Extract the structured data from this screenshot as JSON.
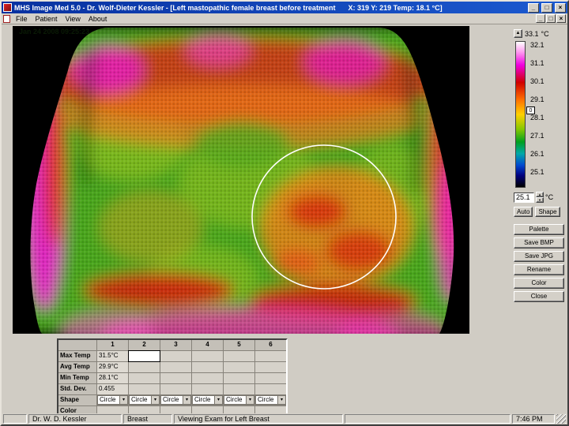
{
  "window": {
    "title_left": "MHS Image Med 5.0  -  Dr. Wolf-Dieter Kessler - [Left mastopathic female breast before treatment",
    "title_right": "X: 319  Y: 219    Temp:  18.1 °C]",
    "controls": {
      "minimize": "_",
      "maximize": "□",
      "close": "×"
    }
  },
  "menu": {
    "items": [
      "File",
      "Patient",
      "View",
      "About"
    ]
  },
  "image": {
    "timestamp": "Jan 24 2008 09:25:23"
  },
  "scale": {
    "unit": "°C",
    "max_label": "33.1",
    "labels": [
      "32.1",
      "31.1",
      "30.1",
      "29.1",
      "28.1",
      "27.1",
      "26.1",
      "25.1"
    ],
    "marker": "0",
    "current": "25.1",
    "auto_label": "Auto",
    "shape_label": "Shape",
    "palette_colors": [
      "#ffffff",
      "#ff9cf0",
      "#f000e0",
      "#d00000",
      "#ff7000",
      "#ffd000",
      "#88c800",
      "#00a020",
      "#00a8a8",
      "#0048d0",
      "#000080",
      "#000000"
    ]
  },
  "sidebar_buttons": [
    "Palette",
    "Save BMP",
    "Save JPG",
    "Rename",
    "Color",
    "Close"
  ],
  "stats_table": {
    "columns": [
      "1",
      "2",
      "3",
      "4",
      "5",
      "6"
    ],
    "rows": [
      {
        "label": "Max Temp",
        "value": "31.5°C"
      },
      {
        "label": "Avg Temp",
        "value": "29.9°C"
      },
      {
        "label": "Min Temp",
        "value": "28.1°C"
      },
      {
        "label": "Std. Dev.",
        "value": "0.455"
      }
    ],
    "shape_label": "Shape",
    "shape_option": "Circle",
    "color_label": "Color"
  },
  "statusbar": {
    "doctor": "Dr. W. D. Kessler",
    "exam_type": "Breast",
    "message": "Viewing Exam for Left Breast",
    "time": "7:46 PM"
  },
  "icons": {
    "dropdown_arrow": "▾",
    "spin_up": "▲",
    "spin_down": "▼"
  }
}
